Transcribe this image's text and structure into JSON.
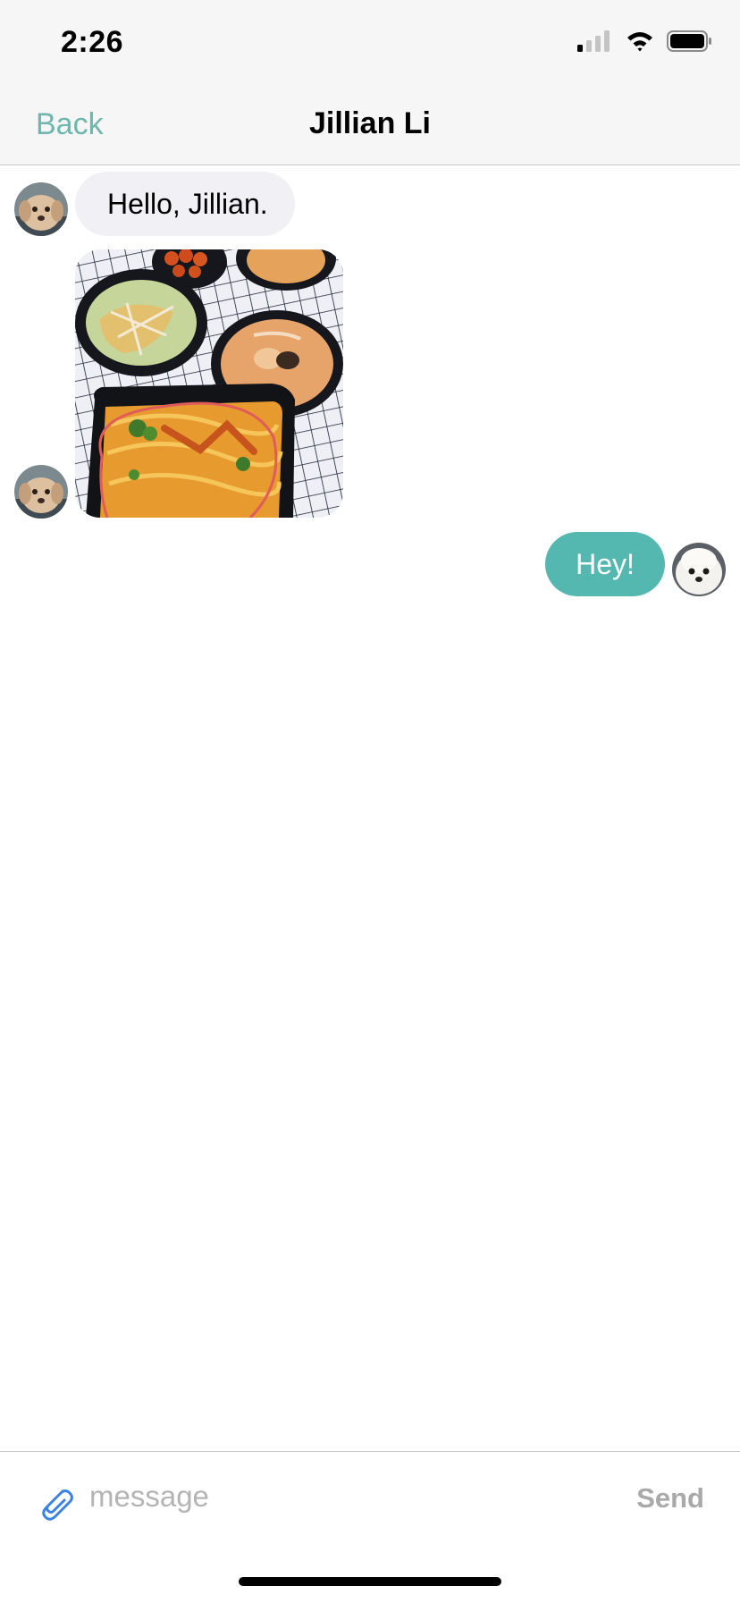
{
  "status_bar": {
    "time": "2:26",
    "signal_icon": "cellular-signal-icon",
    "wifi_icon": "wifi-icon",
    "battery_icon": "battery-icon"
  },
  "nav": {
    "back_label": "Back",
    "title": "Jillian Li"
  },
  "messages": [
    {
      "direction": "received",
      "type": "text",
      "text": "Hello, Jillian."
    },
    {
      "direction": "received",
      "type": "image",
      "image": "food-photo"
    },
    {
      "direction": "sent",
      "type": "text",
      "text": "Hey!"
    }
  ],
  "compose": {
    "attach_icon": "paperclip-icon",
    "placeholder": "message",
    "value": "",
    "send_label": "Send"
  },
  "colors": {
    "accent": "#6fb6ad",
    "sent_bubble": "#55b8b0",
    "received_bubble": "#f0f0f5",
    "bar_background": "#f6f6f6",
    "send_disabled": "#a9a9a9",
    "attach_icon": "#3b82e6"
  }
}
